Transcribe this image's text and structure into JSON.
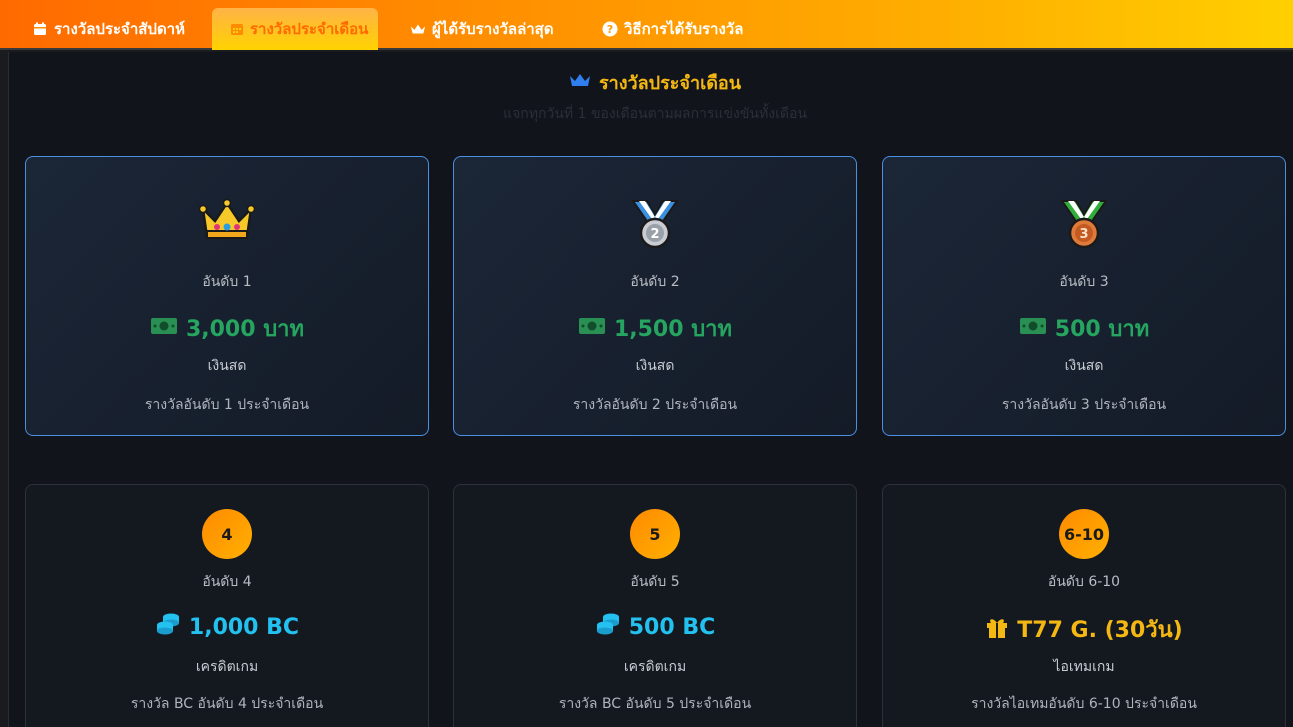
{
  "tabs": [
    {
      "label": "รางวัลประจำสัปดาห์",
      "icon": "calendar-icon"
    },
    {
      "label": "รางวัลประจำเดือน",
      "icon": "calendar-icon",
      "active": true
    },
    {
      "label": "ผู้ได้รับรางวัลล่าสุด",
      "icon": "crown-icon"
    },
    {
      "label": "วิธีการได้รับรางวัล",
      "icon": "question-icon"
    }
  ],
  "section": {
    "title": "รางวัลประจำเดือน",
    "subtitle": "แจกทุกวันที่ 1 ของเดือนตามผลการแข่งขันทั้งเดือน"
  },
  "top_prizes": [
    {
      "rank": "อันดับ 1",
      "amount": "3,000 บาท",
      "type": "เงินสด",
      "desc": "รางวัลอันดับ 1 ประจำเดือน",
      "medal": "crown"
    },
    {
      "rank": "อันดับ 2",
      "amount": "1,500 บาท",
      "type": "เงินสด",
      "desc": "รางวัลอันดับ 2 ประจำเดือน",
      "medal": "silver-medal"
    },
    {
      "rank": "อันดับ 3",
      "amount": "500 บาท",
      "type": "เงินสด",
      "desc": "รางวัลอันดับ 3 ประจำเดือน",
      "medal": "bronze-medal"
    }
  ],
  "other_prizes": [
    {
      "badge": "4",
      "rank": "อันดับ 4",
      "amount": "1,000 BC",
      "type": "เครดิตเกม",
      "desc": "รางวัล BC อันดับ 4 ประจำเดือน",
      "kind": "bc"
    },
    {
      "badge": "5",
      "rank": "อันดับ 5",
      "amount": "500 BC",
      "type": "เครดิตเกม",
      "desc": "รางวัล BC อันดับ 5 ประจำเดือน",
      "kind": "bc"
    },
    {
      "badge": "6-10",
      "rank": "อันดับ 6-10",
      "amount": "T77 G. (30วัน)",
      "type": "ไอเทมเกม",
      "desc": "รางวัลไอเทมอันดับ 6-10 ประจำเดือน",
      "kind": "item"
    }
  ],
  "colors": {
    "accent": "#ff8c00",
    "gold": "#f5b812",
    "cash": "#25a55f",
    "bc": "#22c1f0",
    "card_border": "#4a8fe0"
  }
}
